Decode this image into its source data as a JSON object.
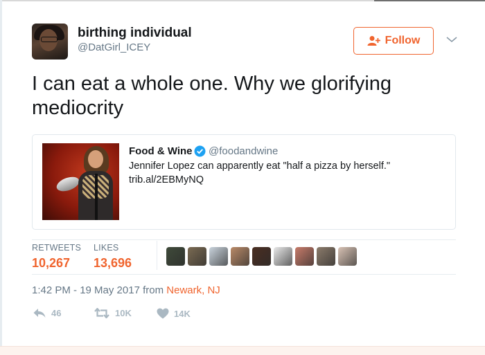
{
  "user": {
    "display_name": "birthing individual",
    "username": "@DatGirl_ICEY"
  },
  "follow_label": "Follow",
  "tweet": {
    "text": "I can eat a whole one. Why we glorifying mediocrity"
  },
  "quoted": {
    "name": "Food & Wine",
    "handle": "@foodandwine",
    "text": "Jennifer Lopez can apparently eat \"half a pizza by herself.\" trib.al/2EBMyNQ"
  },
  "stats": {
    "retweets_label": "RETWEETS",
    "retweets": "10,267",
    "likes_label": "LIKES",
    "likes": "13,696"
  },
  "likers": [
    {
      "icon": "liker-avatar-1",
      "color": "#3f4a3a"
    },
    {
      "icon": "liker-avatar-2",
      "color": "#7a6a52"
    },
    {
      "icon": "liker-avatar-3",
      "color": "#c9d3dc"
    },
    {
      "icon": "liker-avatar-4",
      "color": "#b98a68"
    },
    {
      "icon": "liker-avatar-5",
      "color": "#4a2e22"
    },
    {
      "icon": "liker-avatar-6",
      "color": "#e9e9e9"
    },
    {
      "icon": "liker-avatar-7",
      "color": "#c77b6a"
    },
    {
      "icon": "liker-avatar-8",
      "color": "#8b7b6b"
    },
    {
      "icon": "liker-avatar-9",
      "color": "#d8c2b4"
    }
  ],
  "meta": {
    "time": "1:42 PM - 19 May 2017 from ",
    "location": "Newark, NJ"
  },
  "actions": {
    "reply_count": "46",
    "retweet_count": "10K",
    "like_count": "14K"
  },
  "colors": {
    "accent": "#f0642e",
    "muted": "#657786",
    "icon_gray": "#aab8c2",
    "verified": "#1da1f2"
  }
}
